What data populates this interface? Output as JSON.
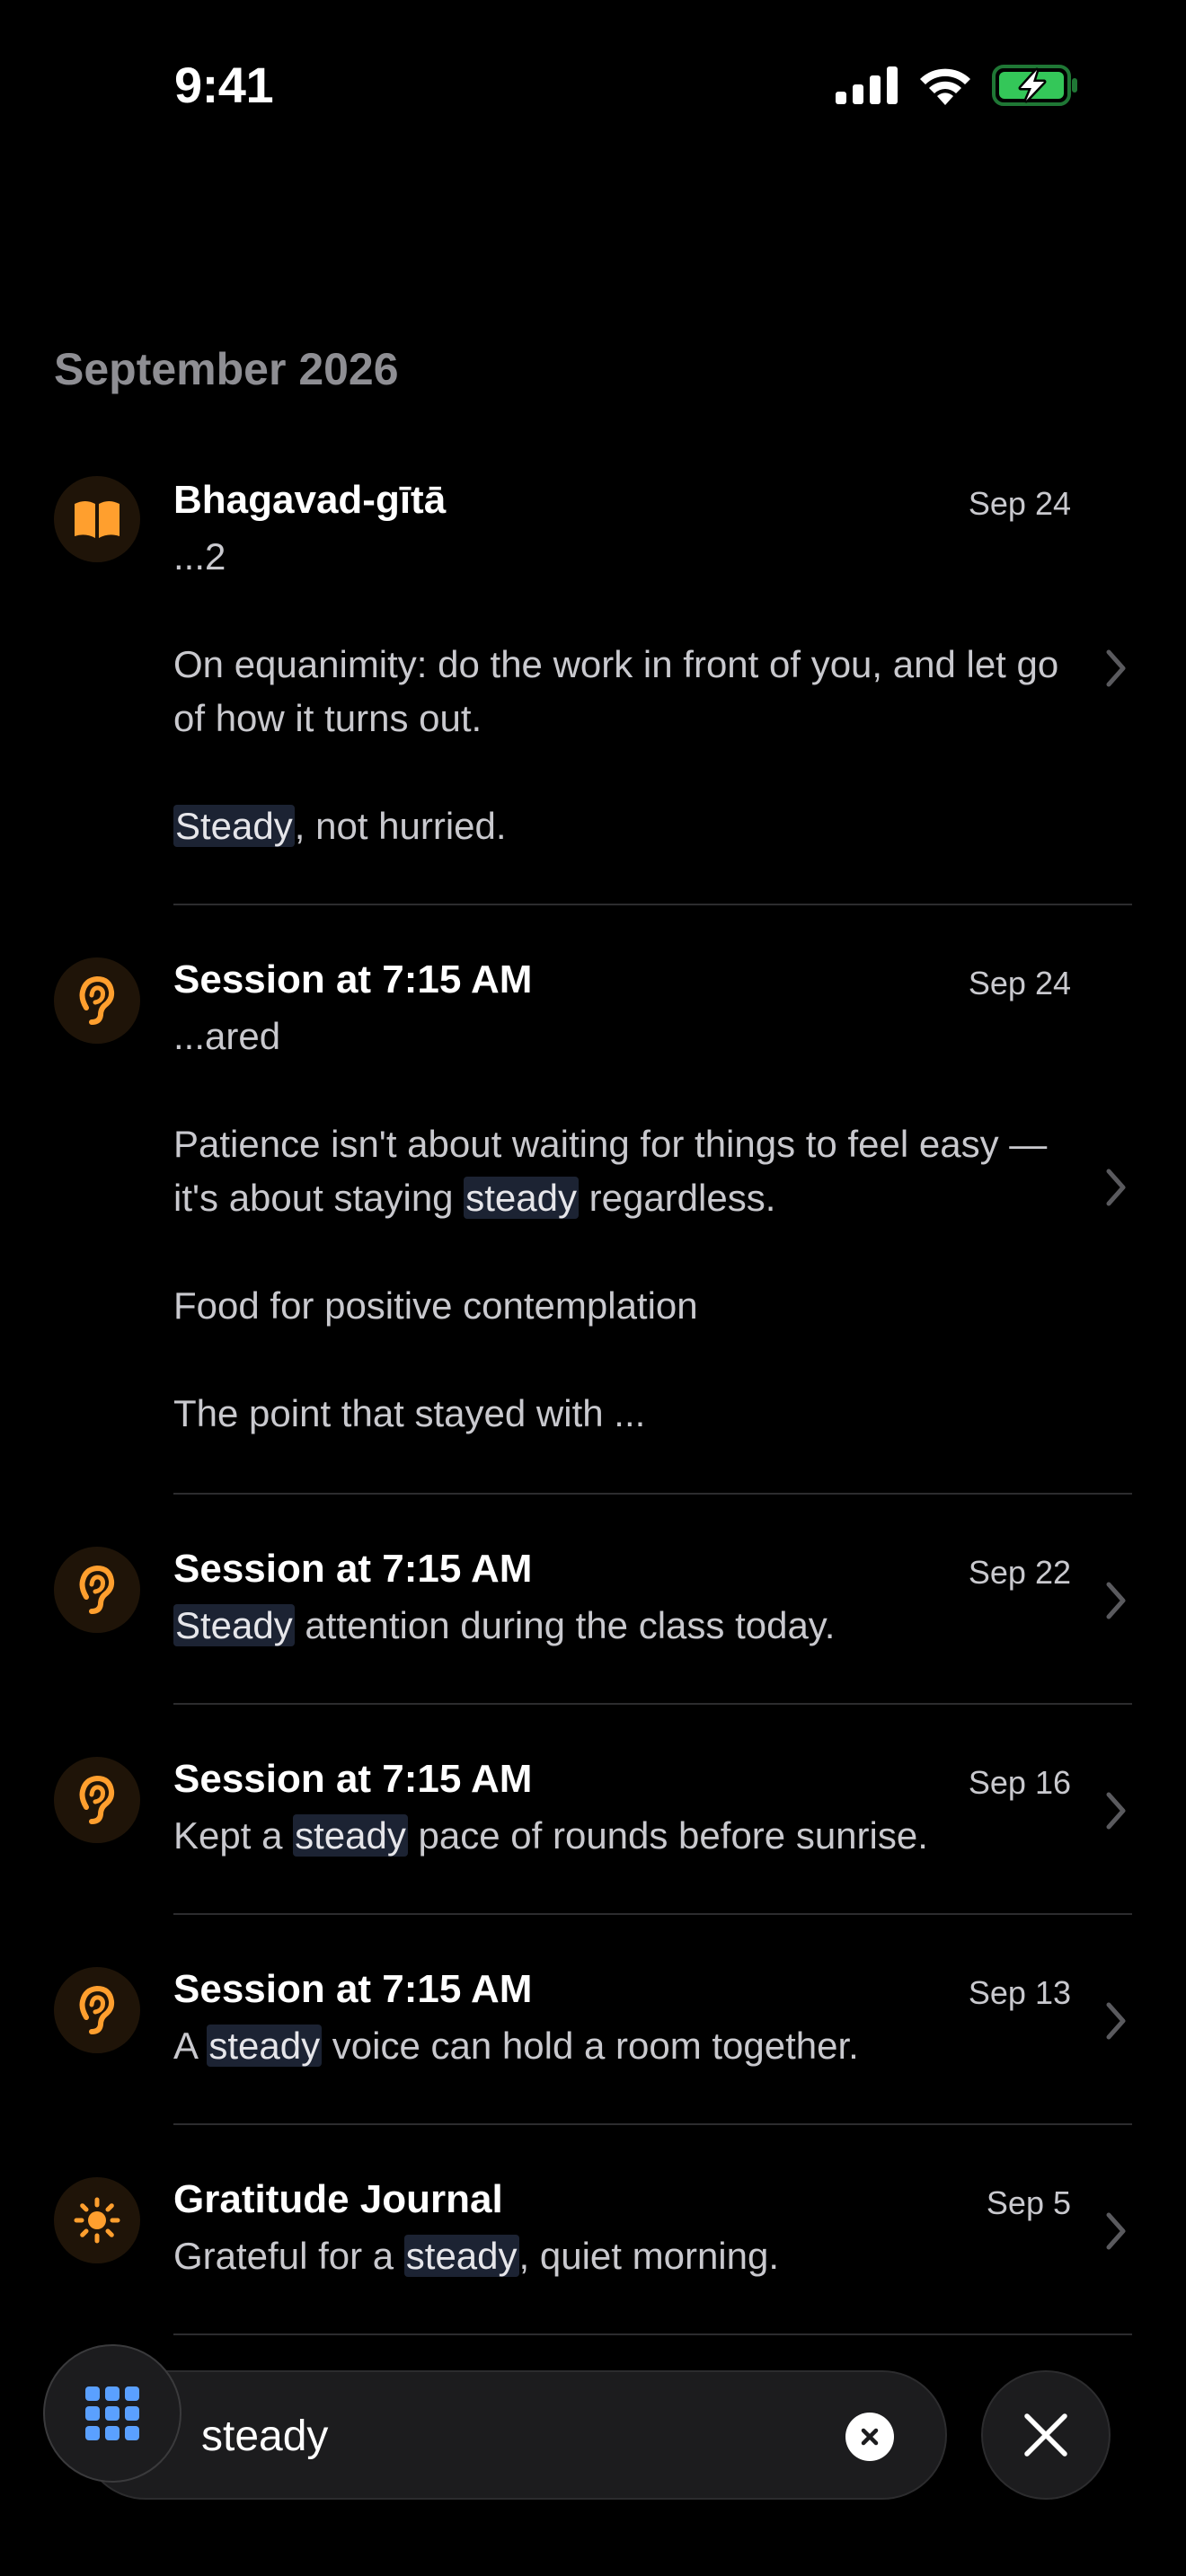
{
  "status_bar": {
    "time": "9:41",
    "icons": [
      "cellular-signal-icon",
      "wifi-icon",
      "battery-charging-icon"
    ]
  },
  "section": {
    "title": "September 2026"
  },
  "colors": {
    "accent_orange": "#ff9f2e",
    "highlight_bg": "#1c2333",
    "battery_green": "#34c759",
    "background": "#000000"
  },
  "entries": [
    {
      "icon": "open-book-icon",
      "title": "Bhagavad-gītā",
      "date": "Sep 24",
      "lines": [
        "...2",
        "On equanimity: do the work in front of you, and let go of how it turns out.",
        "Steady, not hurried."
      ]
    },
    {
      "icon": "ear-icon",
      "title": "Session at 7:15 AM",
      "date": "Sep 24",
      "lines": [
        "...ared",
        "Patience isn't about waiting for things to feel easy — it's about staying steady regardless.",
        "Food for positive contemplation",
        "The point that stayed with ..."
      ]
    },
    {
      "icon": "ear-icon",
      "title": "Session at 7:15 AM",
      "date": "Sep 22",
      "lines": [
        "Steady attention during the class today."
      ]
    },
    {
      "icon": "ear-icon",
      "title": "Session at 7:15 AM",
      "date": "Sep 16",
      "lines": [
        "Kept a steady pace of rounds before sunrise."
      ]
    },
    {
      "icon": "ear-icon",
      "title": "Session at 7:15 AM",
      "date": "Sep 13",
      "lines": [
        "A steady voice can hold a room together."
      ]
    },
    {
      "icon": "sun-icon",
      "title": "Gratitude Journal",
      "date": "Sep 5",
      "lines": [
        "Grateful for a steady, quiet morning."
      ]
    }
  ],
  "search": {
    "value": "steady",
    "highlight_term": "steady",
    "clear_icon": "clear-circle-icon",
    "grid_icon": "grid-icon",
    "close_icon": "close-icon"
  }
}
